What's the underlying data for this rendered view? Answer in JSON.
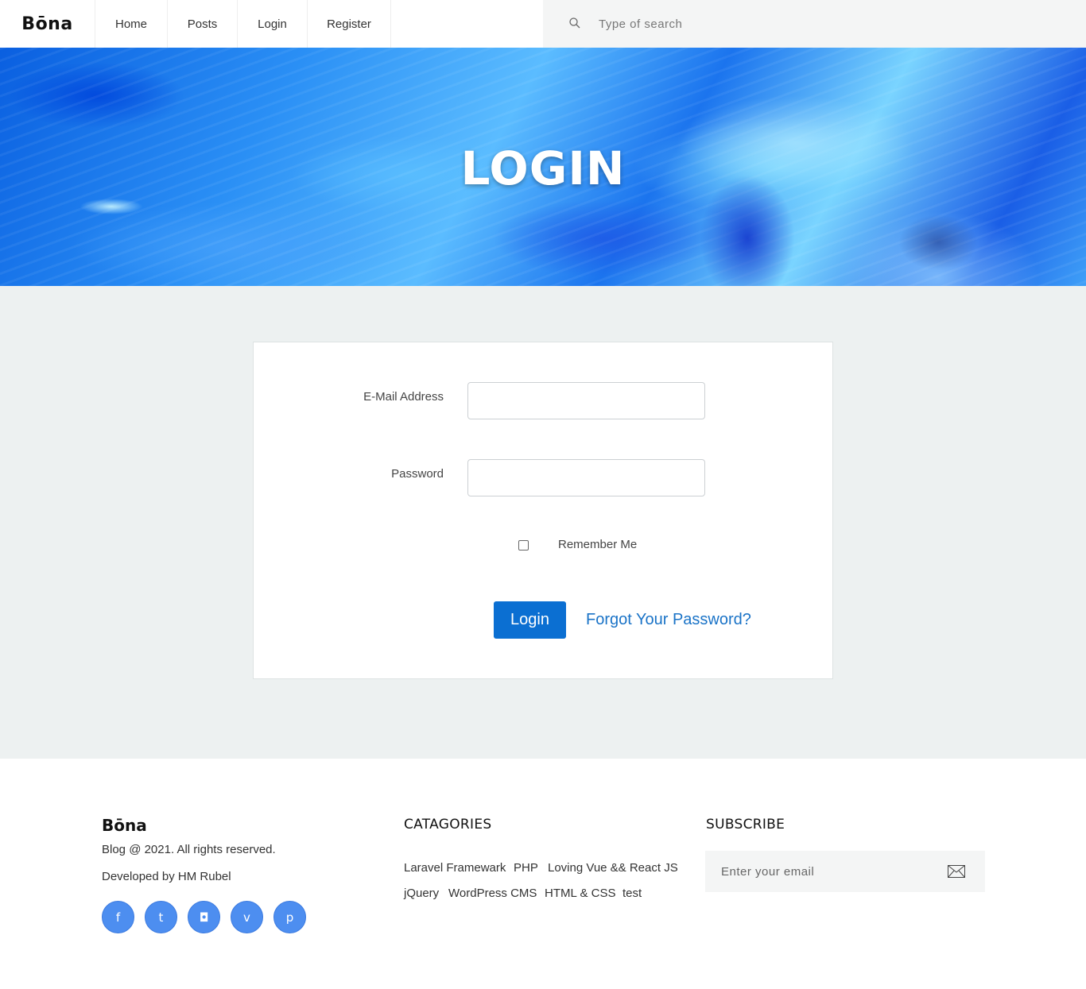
{
  "header": {
    "logo": "Bōna",
    "nav": [
      {
        "label": "Home"
      },
      {
        "label": "Posts"
      },
      {
        "label": "Login"
      },
      {
        "label": "Register"
      }
    ],
    "search_placeholder": "Type of search"
  },
  "hero": {
    "title": "LOGIN"
  },
  "form": {
    "email_label": "E-Mail Address",
    "email_value": "",
    "password_label": "Password",
    "password_value": "",
    "remember_label": "Remember Me",
    "remember_checked": false,
    "login_button": "Login",
    "forgot_link": "Forgot Your Password?",
    "accent_color": "#0b6fd2"
  },
  "footer": {
    "logo": "Bōna",
    "copyright": "Blog @ 2021. All rights reserved.",
    "developer": "Developed by HM Rubel",
    "socials": [
      {
        "icon": "facebook-icon",
        "glyph": "f"
      },
      {
        "icon": "twitter-icon",
        "glyph": "t"
      },
      {
        "icon": "instagram-icon",
        "glyph": "◘"
      },
      {
        "icon": "vimeo-icon",
        "glyph": "v"
      },
      {
        "icon": "pinterest-icon",
        "glyph": "p"
      }
    ],
    "categories_heading": "CATAGORIES",
    "categories": [
      "Laravel Framewark",
      "PHP",
      "Loving Vue && React JS",
      "jQuery",
      "WordPress CMS",
      "HTML & CSS",
      "test"
    ],
    "subscribe_heading": "SUBSCRIBE",
    "subscribe_placeholder": "Enter your email"
  }
}
